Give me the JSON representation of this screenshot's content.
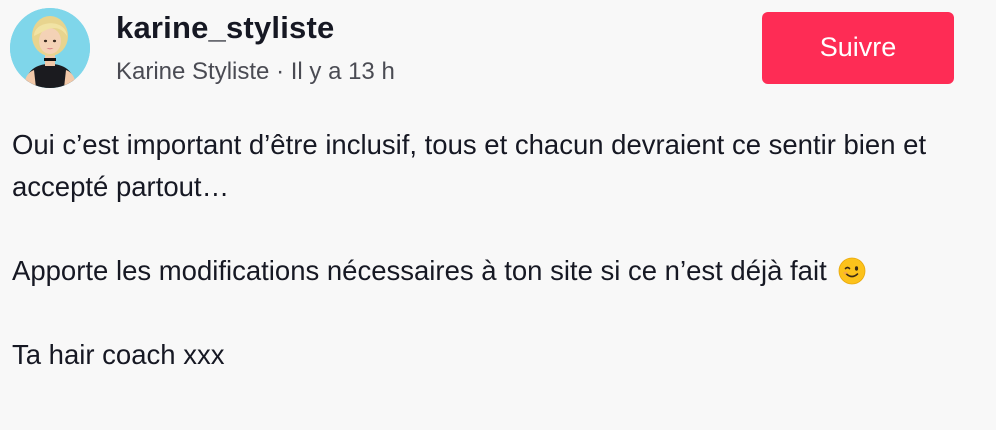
{
  "author": {
    "username": "karine_styliste",
    "display_name": "Karine Styliste",
    "separator": " · ",
    "time_ago": "Il y a 13 h",
    "avatar_icon": "profile-avatar"
  },
  "actions": {
    "follow_label": "Suivre",
    "follow_color": "#fe2c55"
  },
  "comment": {
    "paragraph_1": "Oui c’est important d’être inclusif, tous et chacun devraient ce sentir bien et accepté partout…",
    "paragraph_2": "Apporte les modifications nécessaires à ton site si ce n’est déjà fait",
    "paragraph_2_emoji": "winking-face-icon",
    "paragraph_3": "Ta hair coach xxx"
  }
}
